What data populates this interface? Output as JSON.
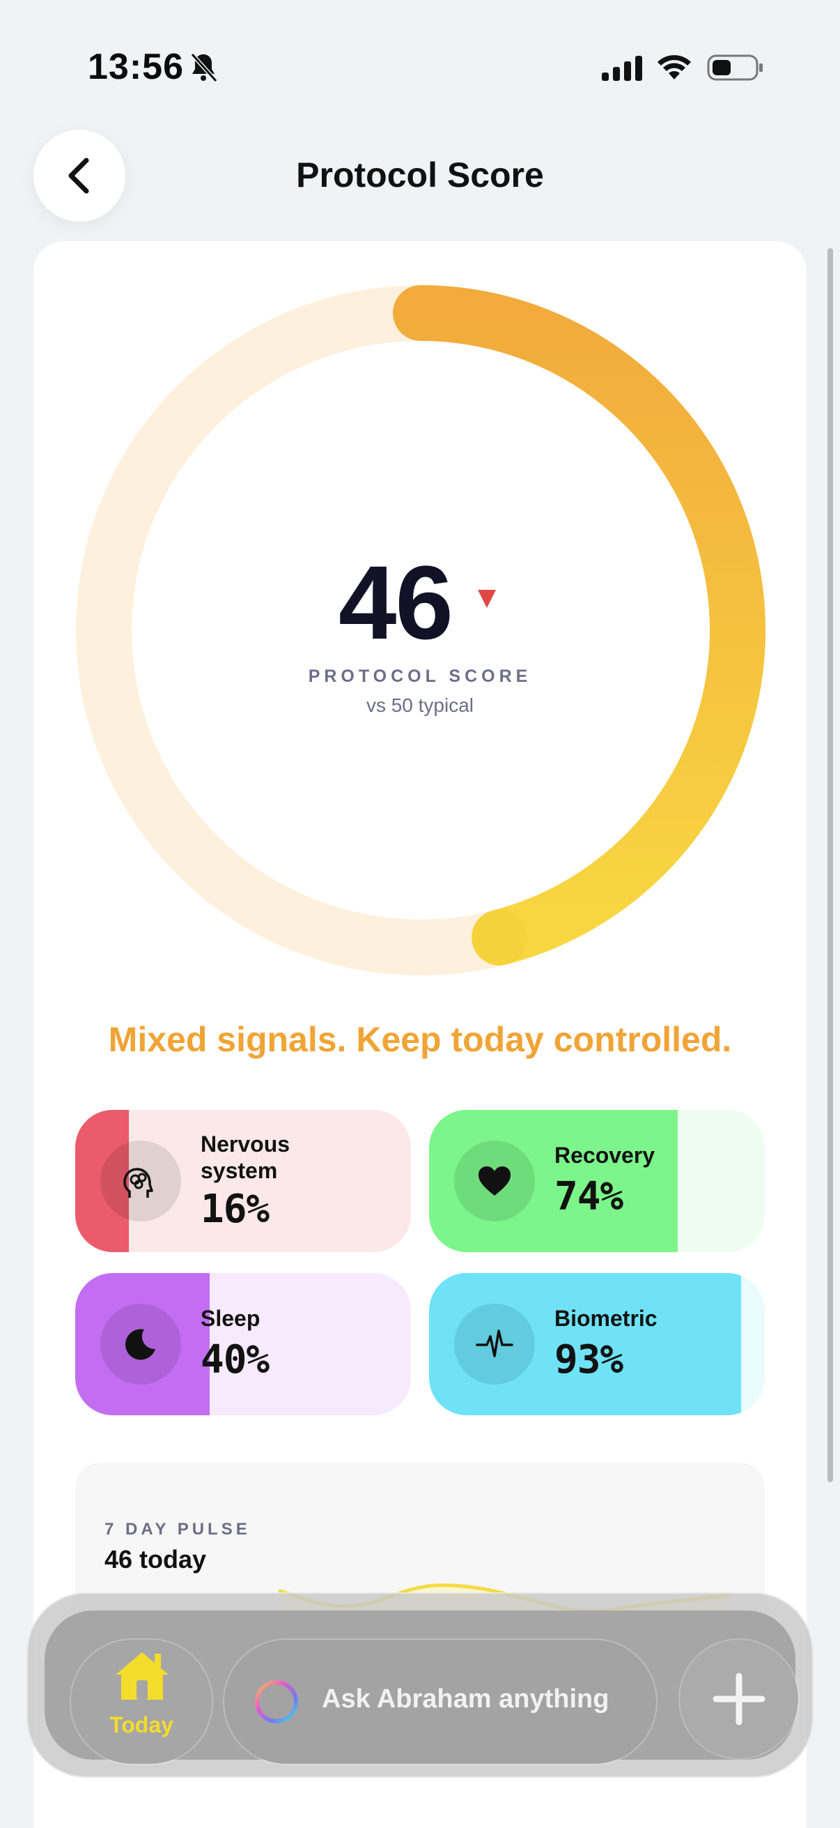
{
  "status_bar": {
    "time": "13:56",
    "icons": [
      "bell-slash-icon",
      "signal-icon",
      "wifi-icon",
      "battery-icon"
    ]
  },
  "header": {
    "title": "Protocol Score",
    "back_icon": "chevron-left-icon"
  },
  "score": {
    "value": "46",
    "progress": 0.46,
    "trend": "down",
    "label": "PROTOCOL SCORE",
    "comparison": "vs 50 typical",
    "colors": {
      "track": "#fdf0dc",
      "start": "#f2ab3c",
      "end": "#f8d742"
    }
  },
  "headline": "Mixed signals. Keep today controlled.",
  "metrics": [
    {
      "label": "Nervous system",
      "value": "16%",
      "fraction": 0.16,
      "icon": "brain-head-icon",
      "fill": "#ea5b6c",
      "bg": "#fbe8e8"
    },
    {
      "label": "Recovery",
      "value": "74%",
      "fraction": 0.74,
      "icon": "heart-icon",
      "fill": "#7cf58a",
      "bg": "#eefdf0"
    },
    {
      "label": "Sleep",
      "value": "40%",
      "fraction": 0.4,
      "icon": "moon-icon",
      "fill": "#c36df2",
      "bg": "#f7eafc"
    },
    {
      "label": "Biometric",
      "value": "93%",
      "fraction": 0.93,
      "icon": "pulse-icon",
      "fill": "#6fe2f8",
      "bg": "#eafbfd"
    }
  ],
  "pulse": {
    "label": "7 DAY PULSE",
    "value": "46 today",
    "line_color": "#f4dc45"
  },
  "bottom_bar": {
    "today_label": "Today",
    "today_icon": "house-icon",
    "ask_placeholder": "Ask Abraham anything",
    "ask_icon": "gradient-ring-icon",
    "plus_icon": "plus-icon",
    "accent": "#f4dc2c"
  }
}
